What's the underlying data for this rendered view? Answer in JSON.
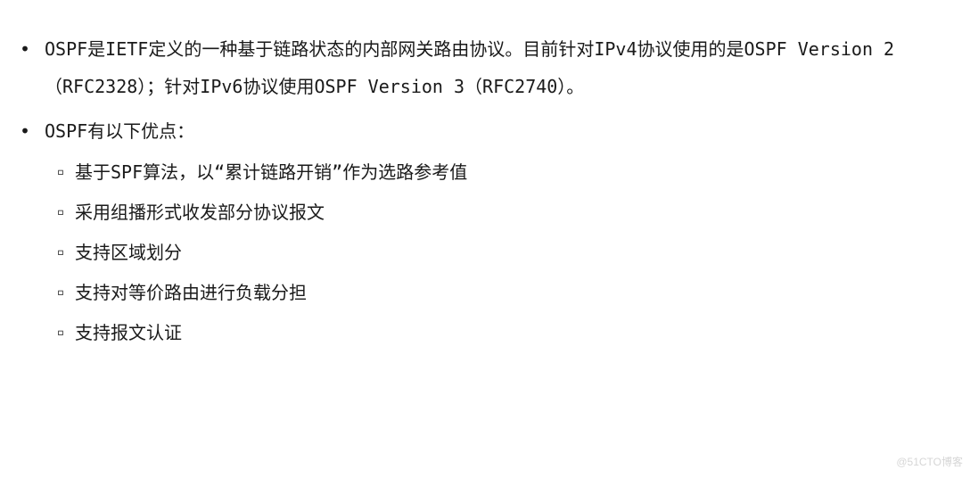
{
  "list": {
    "bullet": "•",
    "sub_bullet": "▫",
    "items": [
      {
        "text": "OSPF是IETF定义的一种基于链路状态的内部网关路由协议。目前针对IPv4协议使用的是OSPF Version 2（RFC2328）；针对IPv6协议使用OSPF Version 3（RFC2740）。"
      },
      {
        "text": "OSPF有以下优点：",
        "subitems": [
          "基于SPF算法，以“累计链路开销”作为选路参考值",
          "采用组播形式收发部分协议报文",
          "支持区域划分",
          "支持对等价路由进行负载分担",
          "支持报文认证"
        ]
      }
    ]
  },
  "watermark": "@51CTO博客"
}
